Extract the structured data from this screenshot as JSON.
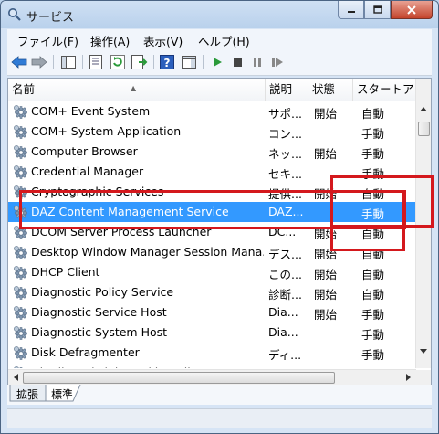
{
  "window": {
    "title": "サービス"
  },
  "menu": [
    {
      "label": "ファイル(F)"
    },
    {
      "label": "操作(A)"
    },
    {
      "label": "表示(V)"
    },
    {
      "label": "ヘルプ(H)"
    }
  ],
  "columns": [
    "名前",
    "説明",
    "状態",
    "スタートア"
  ],
  "services": [
    {
      "name": "COM+ Event System",
      "desc": "サポ...",
      "status": "開始",
      "startup": "自動"
    },
    {
      "name": "COM+ System Application",
      "desc": "コン...",
      "status": "",
      "startup": "手動"
    },
    {
      "name": "Computer Browser",
      "desc": "ネッ...",
      "status": "開始",
      "startup": "手動"
    },
    {
      "name": "Credential Manager",
      "desc": "セキ...",
      "status": "",
      "startup": "手動"
    },
    {
      "name": "Cryptographic Services",
      "desc": "提供...",
      "status": "開始",
      "startup": "自動"
    },
    {
      "name": "DAZ Content Management Service",
      "desc": "DAZ...",
      "status": "",
      "startup": "手動"
    },
    {
      "name": "DCOM Server Process Launcher",
      "desc": "DC...",
      "status": "開始",
      "startup": "自動"
    },
    {
      "name": "Desktop Window Manager Session Mana...",
      "desc": "デス...",
      "status": "開始",
      "startup": "自動"
    },
    {
      "name": "DHCP Client",
      "desc": "この...",
      "status": "開始",
      "startup": "自動"
    },
    {
      "name": "Diagnostic Policy Service",
      "desc": "診断...",
      "status": "開始",
      "startup": "自動"
    },
    {
      "name": "Diagnostic Service Host",
      "desc": "Dia...",
      "status": "開始",
      "startup": "手動"
    },
    {
      "name": "Diagnostic System Host",
      "desc": "Dia...",
      "status": "",
      "startup": "手動"
    },
    {
      "name": "Disk Defragmenter",
      "desc": "ディ...",
      "status": "",
      "startup": "手動"
    },
    {
      "name": "Distributed Link Tracking Client",
      "desc": "",
      "status": "",
      "startup": ""
    }
  ],
  "tabs": [
    {
      "label": "拡張"
    },
    {
      "label": "標準"
    }
  ],
  "colors": {
    "selection": "#3399ff",
    "highlight": "#d4181d"
  }
}
